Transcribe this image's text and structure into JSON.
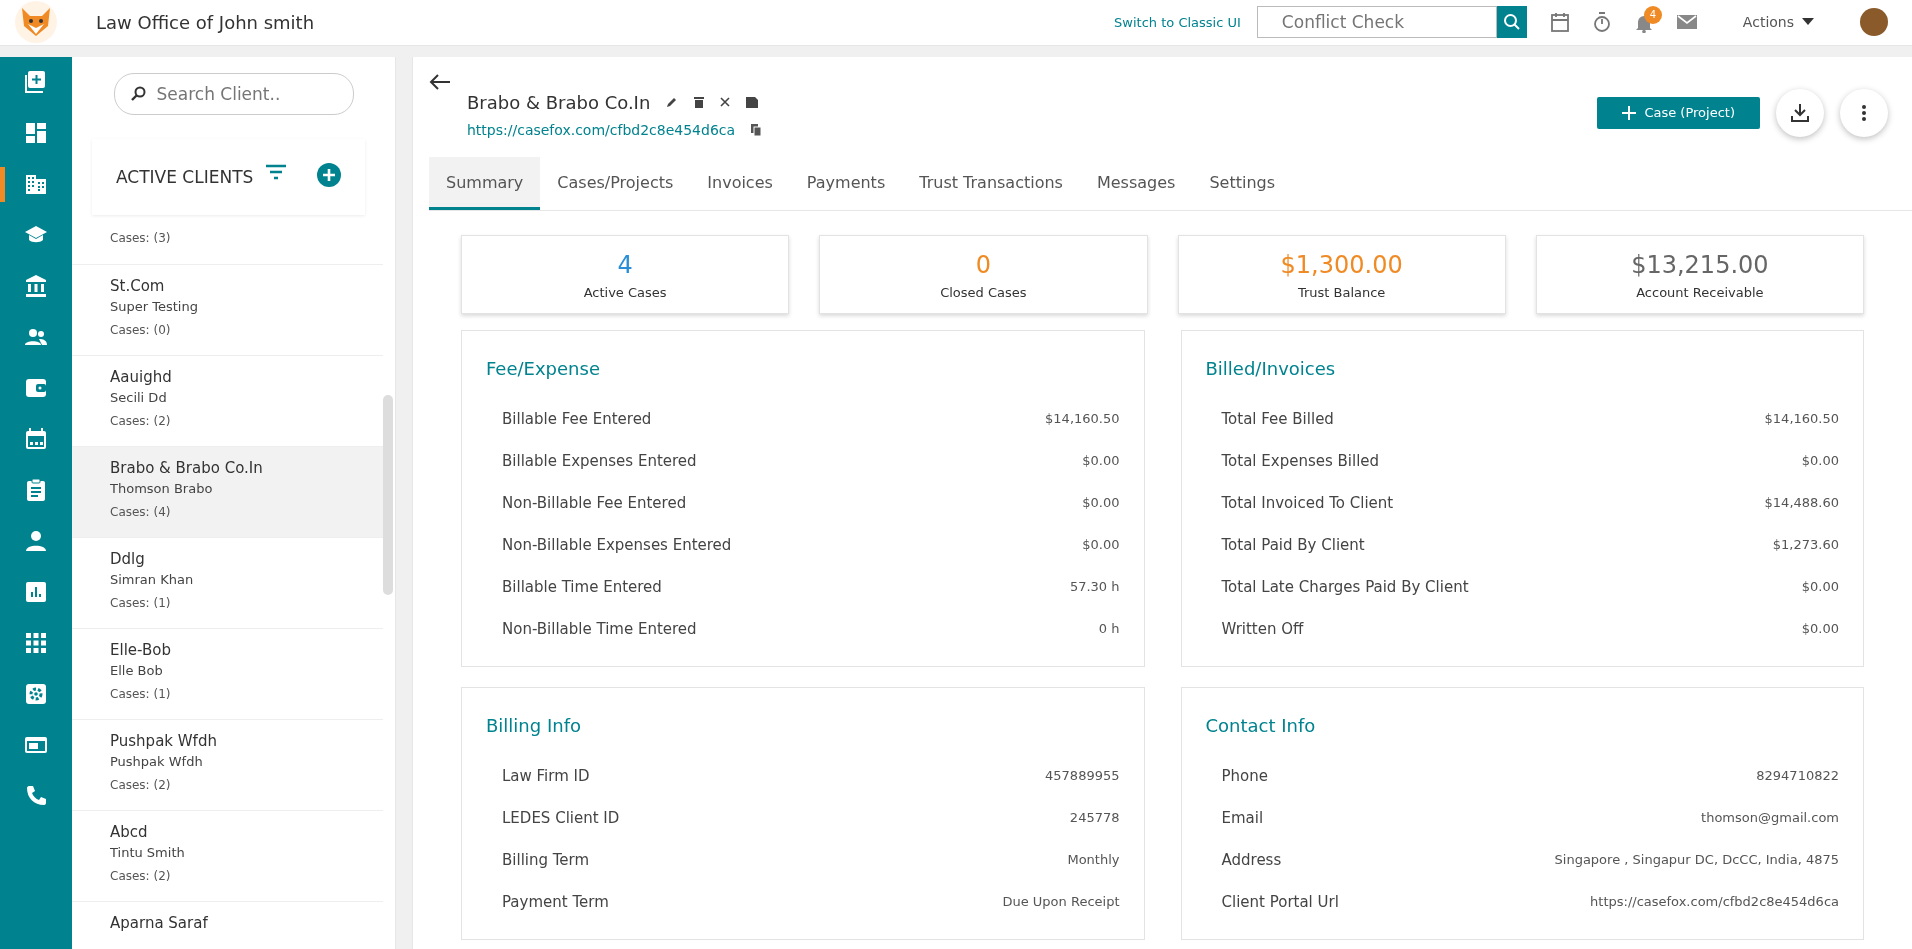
{
  "topbar": {
    "firm": "Law Office of John smith",
    "classic_link": "Switch to Classic UI",
    "conflict_placeholder": "Conflict Check",
    "notification_count": "4",
    "actions": "Actions"
  },
  "rail": [
    {
      "selected": false
    },
    {
      "selected": false
    },
    {
      "selected": true
    },
    {
      "selected": false
    },
    {
      "selected": false
    },
    {
      "selected": false
    },
    {
      "selected": false
    },
    {
      "selected": false
    },
    {
      "selected": false
    },
    {
      "selected": false
    },
    {
      "selected": false
    },
    {
      "selected": false
    },
    {
      "selected": false
    },
    {
      "selected": false
    },
    {
      "selected": false
    }
  ],
  "client_panel": {
    "search_placeholder": "Search Client..",
    "title": "ACTIVE CLIENTS",
    "clients": [
      {
        "cases": "Cases: (3)",
        "selected": false
      },
      {
        "name": "St.Com",
        "contact": "Super Testing",
        "cases": "Cases: (0)",
        "selected": false
      },
      {
        "name": "Aauighd",
        "contact": "Secili Dd",
        "cases": "Cases: (2)",
        "selected": false
      },
      {
        "name": "Brabo & Brabo Co.In",
        "contact": "Thomson Brabo",
        "cases": "Cases: (4)",
        "selected": true
      },
      {
        "name": "Ddlg",
        "contact": "Simran Khan",
        "cases": "Cases: (1)",
        "selected": false
      },
      {
        "name": "Elle-Bob",
        "contact": "Elle Bob",
        "cases": "Cases: (1)",
        "selected": false
      },
      {
        "name": "Pushpak Wfdh",
        "contact": "Pushpak Wfdh",
        "cases": "Cases: (2)",
        "selected": false
      },
      {
        "name": "Abcd",
        "contact": "Tintu Smith",
        "cases": "Cases: (2)",
        "selected": false
      },
      {
        "name": "Aparna Saraf",
        "selected": false
      }
    ]
  },
  "client": {
    "name": "Brabo & Brabo Co.In",
    "url": "https://casefox.com/cfbd2c8e454d6ca",
    "new_case": "Case (Project)"
  },
  "tabs": [
    {
      "label": "Summary",
      "selected": true
    },
    {
      "label": "Cases/Projects",
      "selected": false
    },
    {
      "label": "Invoices",
      "selected": false
    },
    {
      "label": "Payments",
      "selected": false
    },
    {
      "label": "Trust Transactions",
      "selected": false
    },
    {
      "label": "Messages",
      "selected": false
    },
    {
      "label": "Settings",
      "selected": false
    }
  ],
  "stats": [
    {
      "value": "4",
      "label": "Active Cases",
      "color": "#2a8fd6"
    },
    {
      "value": "0",
      "label": "Closed Cases",
      "color": "#f08a24"
    },
    {
      "value": "$1,300.00",
      "label": "Trust Balance",
      "color": "#f08a24"
    },
    {
      "value": "$13,215.00",
      "label": "Account Receivable",
      "color": "#666666"
    }
  ],
  "sections": [
    {
      "title": "Fee/Expense",
      "rows": [
        {
          "label": "Billable Fee Entered",
          "value": "$14,160.50"
        },
        {
          "label": "Billable Expenses Entered",
          "value": "$0.00"
        },
        {
          "label": "Non-Billable Fee Entered",
          "value": "$0.00"
        },
        {
          "label": "Non-Billable Expenses Entered",
          "value": "$0.00"
        },
        {
          "label": "Billable Time Entered",
          "value": "57.30 h"
        },
        {
          "label": "Non-Billable Time Entered",
          "value": "0 h"
        }
      ]
    },
    {
      "title": "Billed/Invoices",
      "rows": [
        {
          "label": "Total Fee Billed",
          "value": "$14,160.50"
        },
        {
          "label": "Total Expenses Billed",
          "value": "$0.00"
        },
        {
          "label": "Total Invoiced To Client",
          "value": "$14,488.60"
        },
        {
          "label": "Total Paid By Client",
          "value": "$1,273.60"
        },
        {
          "label": "Total Late Charges Paid By Client",
          "value": "$0.00"
        },
        {
          "label": "Written Off",
          "value": "$0.00"
        }
      ]
    },
    {
      "title": "Billing Info",
      "rows": [
        {
          "label": "Law Firm ID",
          "value": "457889955"
        },
        {
          "label": "LEDES Client ID",
          "value": "245778"
        },
        {
          "label": "Billing Term",
          "value": "Monthly"
        },
        {
          "label": "Payment Term",
          "value": "Due Upon Receipt"
        }
      ]
    },
    {
      "title": "Contact Info",
      "rows": [
        {
          "label": "Phone",
          "value": "8294710822"
        },
        {
          "label": "Email",
          "value": "thomson@gmail.com"
        },
        {
          "label": "Address",
          "value": "Singapore , Singapur DC, DcCC, India, 4875"
        },
        {
          "label": "Client Portal Url",
          "value": "https://casefox.com/cfbd2c8e454d6ca"
        }
      ]
    }
  ]
}
